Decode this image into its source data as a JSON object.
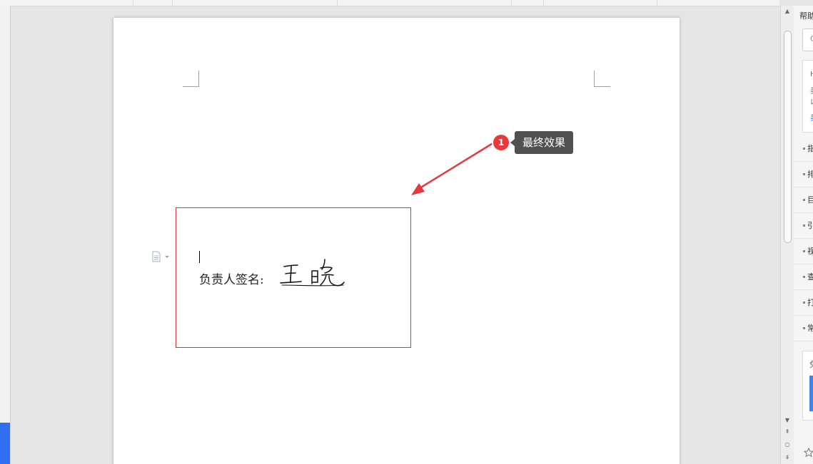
{
  "document": {
    "signature_label": "负责人签名:",
    "signature_name": "王晓"
  },
  "annotation": {
    "badge_number": "1",
    "tooltip_text": "最终效果"
  },
  "side_panel": {
    "title": "帮助",
    "search_placeholder": "Q",
    "card_lines": [
      "H",
      "美",
      "以",
      "美"
    ],
    "items": [
      "指",
      "排",
      "目",
      "引",
      "视",
      "查",
      "打",
      "常"
    ],
    "thumb_label": "免"
  },
  "colors": {
    "highlight_border": "#e03030",
    "badge": "#e8383b",
    "tooltip_bg": "#505050",
    "left_accent": "#2f6ff0"
  }
}
